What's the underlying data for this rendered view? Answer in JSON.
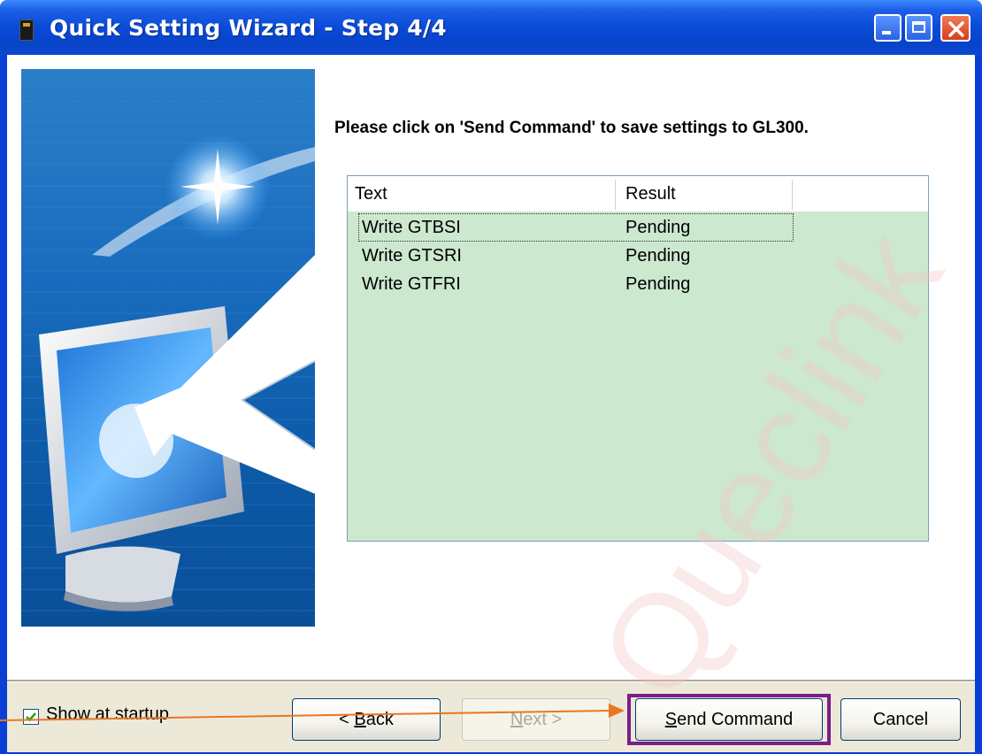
{
  "window": {
    "title": "Quick Setting Wizard - Step 4/4"
  },
  "main": {
    "prompt": "Please click on 'Send Command' to save settings to GL300."
  },
  "list": {
    "columns": [
      "Text",
      "Result"
    ],
    "rows": [
      {
        "text": "Write GTBSI",
        "result": "Pending"
      },
      {
        "text": "Write GTSRI",
        "result": "Pending"
      },
      {
        "text": "Write GTFRI",
        "result": "Pending"
      }
    ],
    "background_color": "#cce8cf"
  },
  "footer": {
    "show_at_startup_label": "Show at startup",
    "show_at_startup_checked": true,
    "back_label": "< Back",
    "next_label": "Next >",
    "send_label": "Send Command",
    "cancel_label": "Cancel"
  },
  "watermark": {
    "text": "Queclink",
    "color": "#f4c4c4"
  },
  "annotation": {
    "arrow_color": "#e87722",
    "highlight_color": "#7b1e87"
  },
  "colors": {
    "titlebar": "#0a4ad8",
    "footer_bg": "#ece9d8"
  }
}
